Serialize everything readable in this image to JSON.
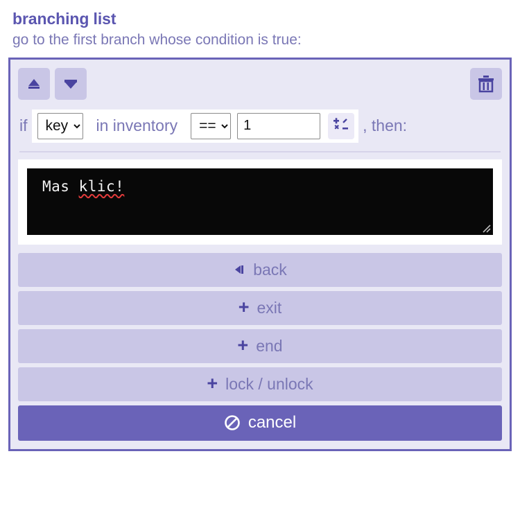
{
  "header": {
    "title": "branching list",
    "subtitle": "go to the first branch whose condition is true:"
  },
  "colors": {
    "panel_border": "#6a63b8",
    "panel_bg": "#e9e8f5",
    "button_bg": "#c9c6e6",
    "primary_bg": "#6a63b8",
    "text_purple": "#7a77b5",
    "title_purple": "#5b56b0",
    "editor_bg": "#080808",
    "editor_text": "#f2f2f2",
    "spellcheck_red": "#e33b3b"
  },
  "toolbar": {
    "move_up": {
      "icon": "arrow-up-icon",
      "label": ""
    },
    "move_down": {
      "icon": "arrow-down-icon",
      "label": ""
    },
    "delete": {
      "icon": "trash-icon",
      "label": ""
    }
  },
  "condition": {
    "if_label": "if",
    "item_select": {
      "value": "key",
      "options": [
        "key"
      ]
    },
    "in_inventory_label": "in inventory",
    "operator_select": {
      "value": "==",
      "options": [
        "==",
        "!=",
        ">",
        "<",
        ">=",
        "<="
      ]
    },
    "amount_input": {
      "value": "1",
      "placeholder": ""
    },
    "math_button": {
      "icon": "math-operations-icon"
    },
    "then_label": ", then:"
  },
  "editor": {
    "text_plain": "Mas ",
    "text_misspelled": "klic!",
    "full_text": "Mas klic!"
  },
  "actions": [
    {
      "label": "back",
      "icon": "back-arrow-icon",
      "style": "secondary"
    },
    {
      "label": "exit",
      "icon": "plus-icon",
      "style": "secondary"
    },
    {
      "label": "end",
      "icon": "plus-icon",
      "style": "secondary"
    },
    {
      "label": "lock / unlock",
      "icon": "plus-icon",
      "style": "secondary"
    },
    {
      "label": "cancel",
      "icon": "no-entry-icon",
      "style": "primary"
    }
  ]
}
